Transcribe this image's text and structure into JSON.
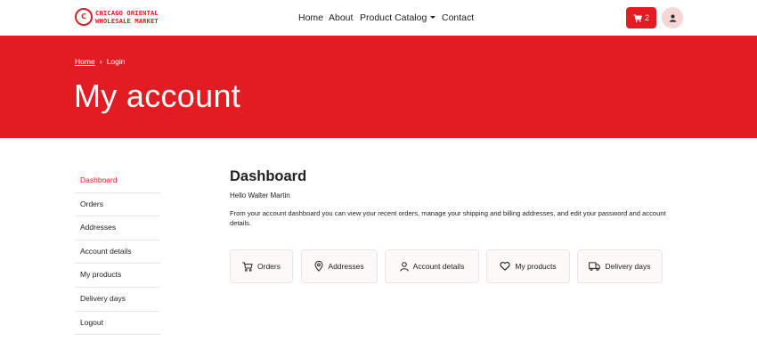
{
  "header": {
    "logo_mark": "C",
    "logo_line1": "CHICAGO ORIENTAL",
    "logo_line2": "WHOLESALE MARKET",
    "nav": [
      "Home",
      "About",
      "Product Catalog",
      "Contact"
    ],
    "cart_count": "2",
    "cart_icon": "shopping-cart-icon",
    "user_icon": "user-icon"
  },
  "hero": {
    "breadcrumb_home": "Home",
    "breadcrumb_sep": "›",
    "breadcrumb_current": "Login",
    "title": "My account"
  },
  "sidebar": {
    "items": [
      "Dashboard",
      "Orders",
      "Addresses",
      "Account details",
      "My products",
      "Delivery days",
      "Logout"
    ],
    "active": "Dashboard"
  },
  "main": {
    "title": "Dashboard",
    "hello": "Hello Walter Martin",
    "description": "From your account dashboard you can view your recent orders, manage your shipping and billing addresses, and edit your password and account details.",
    "cards": [
      {
        "label": "Orders",
        "icon": "cart-icon"
      },
      {
        "label": "Addresses",
        "icon": "location-pin-icon"
      },
      {
        "label": "Account details",
        "icon": "user-icon"
      },
      {
        "label": "My products",
        "icon": "heart-icon"
      },
      {
        "label": "Delivery days",
        "icon": "truck-icon"
      }
    ]
  },
  "colors": {
    "brand_red": "#e31b23",
    "user_bubble": "#f6d5d6",
    "card_bg": "#fdf9f9"
  }
}
